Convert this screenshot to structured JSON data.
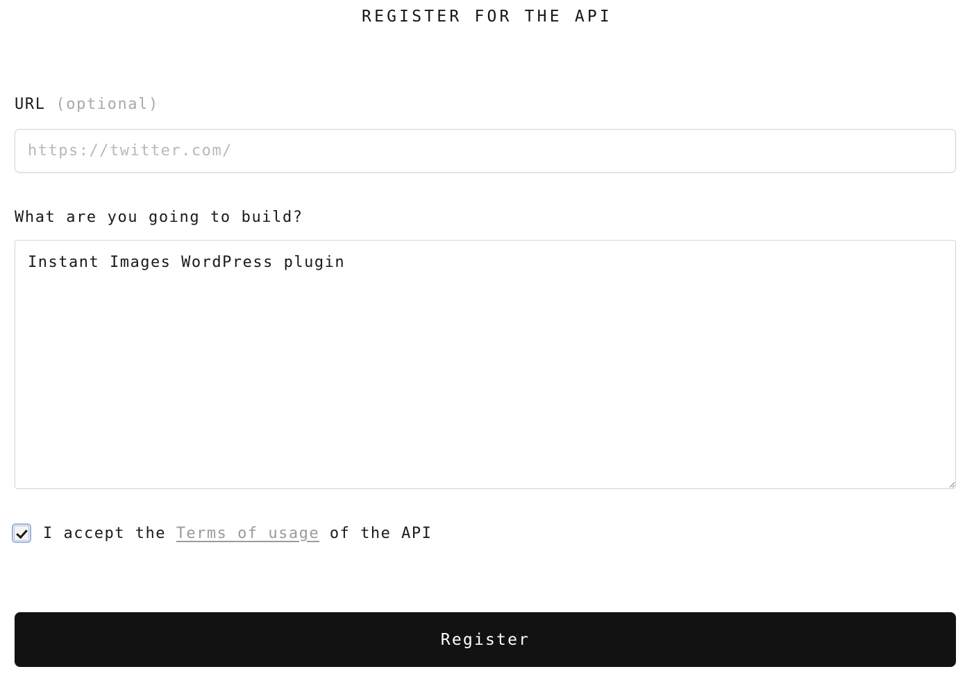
{
  "form": {
    "title": "REGISTER FOR THE API",
    "url_field": {
      "label_main": "URL",
      "label_optional": "(optional)",
      "placeholder": "https://twitter.com/",
      "value": ""
    },
    "build_field": {
      "label": "What are you going to build?",
      "value": "Instant Images WordPress plugin",
      "placeholder": ""
    },
    "terms": {
      "checked": true,
      "text_before": "I accept the ",
      "link_label": "Terms of usage",
      "text_after": " of the API"
    },
    "submit": {
      "label": "Register"
    }
  },
  "colors": {
    "page_background": "#ffffff",
    "text_primary": "#1a1a1a",
    "text_muted": "#a9a9a9",
    "placeholder": "#b8b8b8",
    "border": "#d5d5d5",
    "button_background": "#121212",
    "button_text": "#ffffff",
    "link": "#9a9a9a",
    "checkbox_focus_ring": "#93b3e0"
  }
}
